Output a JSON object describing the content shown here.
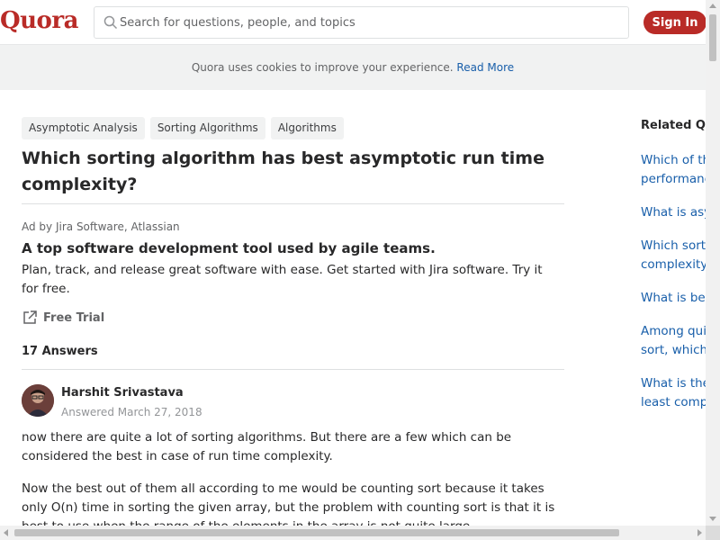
{
  "header": {
    "logo": "Quora",
    "search_placeholder": "Search for questions, people, and topics",
    "signin_label": "Sign In"
  },
  "cookie_banner": {
    "text": "Quora uses cookies to improve your experience.",
    "link": "Read More"
  },
  "question": {
    "topics": [
      "Asymptotic Analysis",
      "Sorting Algorithms",
      "Algorithms"
    ],
    "title": "Which sorting algorithm has best asymptotic run time complexity?"
  },
  "ad": {
    "label": "Ad by Jira Software, Atlassian",
    "title": "A top software development tool used by agile teams.",
    "body": "Plan, track, and release great software with ease. Get started with Jira software. Try it for free.",
    "cta": "Free Trial"
  },
  "answers": {
    "count_label": "17 Answers",
    "first": {
      "author": "Harshit Srivastava",
      "date": "Answered March 27, 2018",
      "paragraph1": "now there are quite a lot of sorting algorithms. But there are a few which can be considered the best in case of run time complexity.",
      "paragraph2": "Now the best out of them all according to me would be counting sort because it takes only O(n) time in sorting the given array, but the problem with counting sort is that it is best to use when the range of the elements in the array is not quite large."
    }
  },
  "sidebar": {
    "title": "Related Questions",
    "items": [
      {
        "line1": "Which of the",
        "line2": "performance"
      },
      {
        "line1": "What is asymptotic",
        "line2": ""
      },
      {
        "line1": "Which sorting",
        "line2": "complexity"
      },
      {
        "line1": "What is best",
        "line2": ""
      },
      {
        "line1": "Among quick",
        "line2": "sort, which"
      },
      {
        "line1": "What is the",
        "line2": "least complexity"
      }
    ]
  },
  "colors": {
    "brand": "#b92b27",
    "link": "#195faa",
    "banner_bg": "#f1f2f2"
  }
}
